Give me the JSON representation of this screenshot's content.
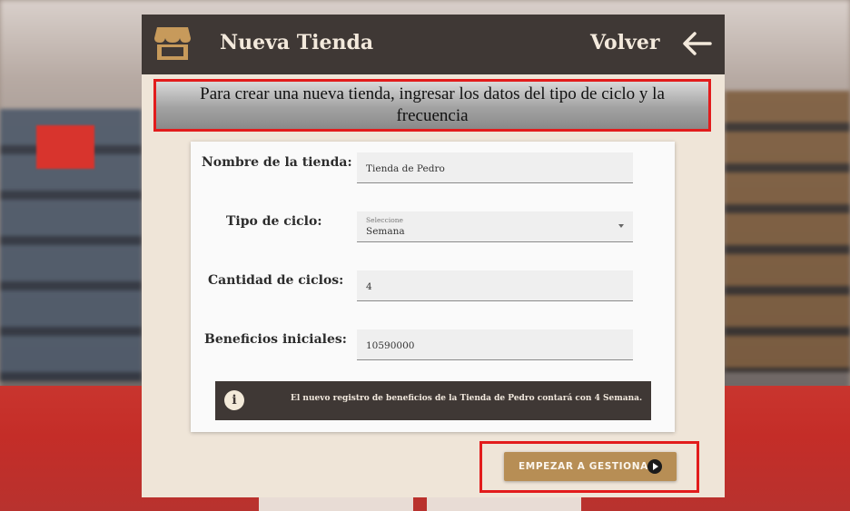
{
  "header": {
    "title": "Nueva Tienda",
    "back_label": "Volver"
  },
  "instruction": "Para crear una nueva tienda, ingresar los datos del tipo de ciclo y la frecuencia",
  "form": {
    "store_name": {
      "label": "Nombre de la tienda:",
      "value": "Tienda de Pedro"
    },
    "cycle_type": {
      "label": "Tipo de ciclo:",
      "hint": "Seleccione",
      "value": "Semana"
    },
    "cycle_count": {
      "label": "Cantidad de ciclos:",
      "value": "4"
    },
    "initial_benefits": {
      "label": "Beneficios iniciales:",
      "value": "10590000"
    }
  },
  "info": {
    "icon": "info-icon",
    "text": "El nuevo registro de beneficios de la Tienda de Pedro contará con 4 Semana."
  },
  "start_button": {
    "label": "EMPEZAR A GESTIONAR",
    "icon": "play-circle-icon"
  },
  "colors": {
    "header_bg": "#3f3835",
    "panel_bg": "#efe5d8",
    "accent": "#b78e55",
    "highlight_border": "#e21c1c"
  }
}
